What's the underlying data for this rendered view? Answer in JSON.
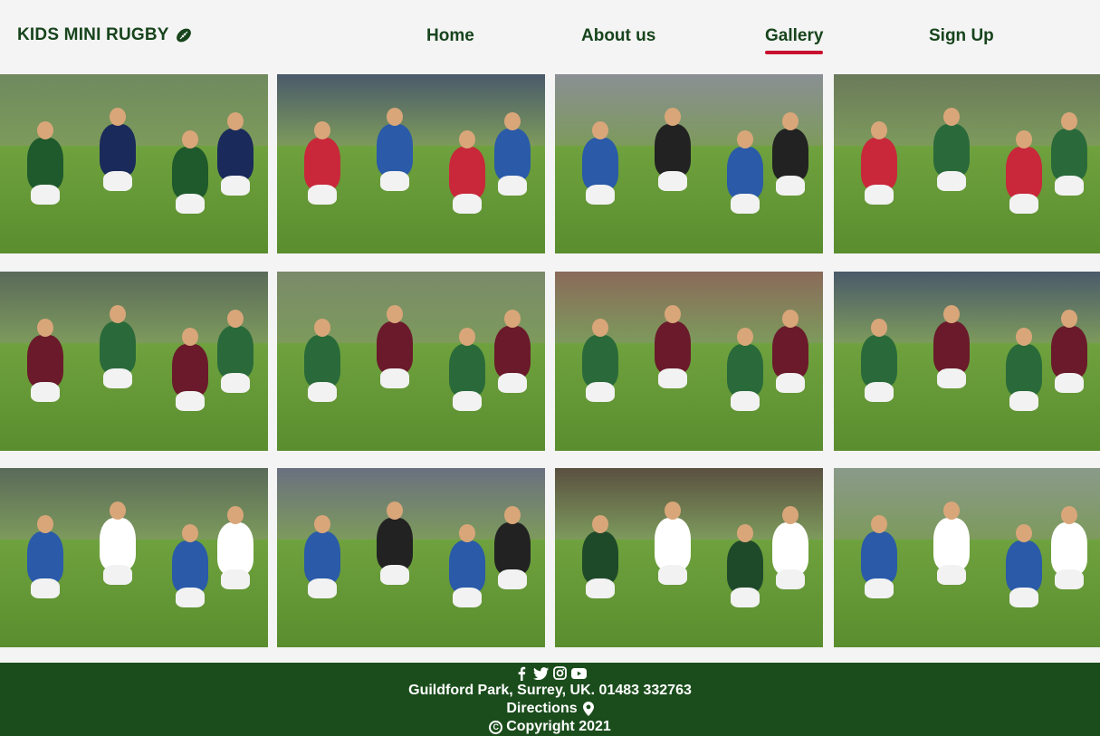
{
  "brand": {
    "name": "KIDS MINI RUGBY",
    "icon": "rugby-ball-icon"
  },
  "nav": {
    "items": [
      {
        "label": "Home",
        "active": false
      },
      {
        "label": "About us",
        "active": false
      },
      {
        "label": "Gallery",
        "active": true
      },
      {
        "label": "Sign Up",
        "active": false
      }
    ]
  },
  "gallery": {
    "photos": [
      {
        "description": "rugby-tackle-photo",
        "jersey": "#1f5a2c",
        "opp": "#1a2a5a"
      },
      {
        "description": "rugby-dive-photo",
        "jersey": "#c8283a",
        "opp": "#2a5aa8"
      },
      {
        "description": "rugby-try-photo",
        "jersey": "#2a5aa8",
        "opp": "#222222"
      },
      {
        "description": "rugby-ruck-photo",
        "jersey": "#c8283a",
        "opp": "#2a6a3a"
      },
      {
        "description": "rugby-tackle-photo",
        "jersey": "#6a1a2a",
        "opp": "#2a6a3a"
      },
      {
        "description": "rugby-pile-photo",
        "jersey": "#2a6a3a",
        "opp": "#6a1a2a"
      },
      {
        "description": "rugby-run-photo",
        "jersey": "#2a6a3a",
        "opp": "#6a1a2a"
      },
      {
        "description": "rugby-carry-photo",
        "jersey": "#2a6a3a",
        "opp": "#6a1a2a"
      },
      {
        "description": "rugby-fend-photo",
        "jersey": "#2a5aa8",
        "opp": "#ffffff"
      },
      {
        "description": "rugby-sprint-photo",
        "jersey": "#2a5aa8",
        "opp": "#222222"
      },
      {
        "description": "rugby-huddle-photo",
        "jersey": "#1f4a2a",
        "opp": "#ffffff"
      },
      {
        "description": "rugby-score-photo",
        "jersey": "#2a5aa8",
        "opp": "#ffffff"
      }
    ]
  },
  "footer": {
    "socials": [
      "facebook-icon",
      "twitter-icon",
      "instagram-icon",
      "youtube-icon"
    ],
    "address": "Guildford Park, Surrey, UK. 01483 332763",
    "directions": "Directions",
    "copyright": "Copyright 2021"
  },
  "colors": {
    "brand_green": "#17441c",
    "footer_green": "#1b4d1c",
    "accent_red": "#c8102e",
    "page_bg": "#f4f4f4"
  }
}
